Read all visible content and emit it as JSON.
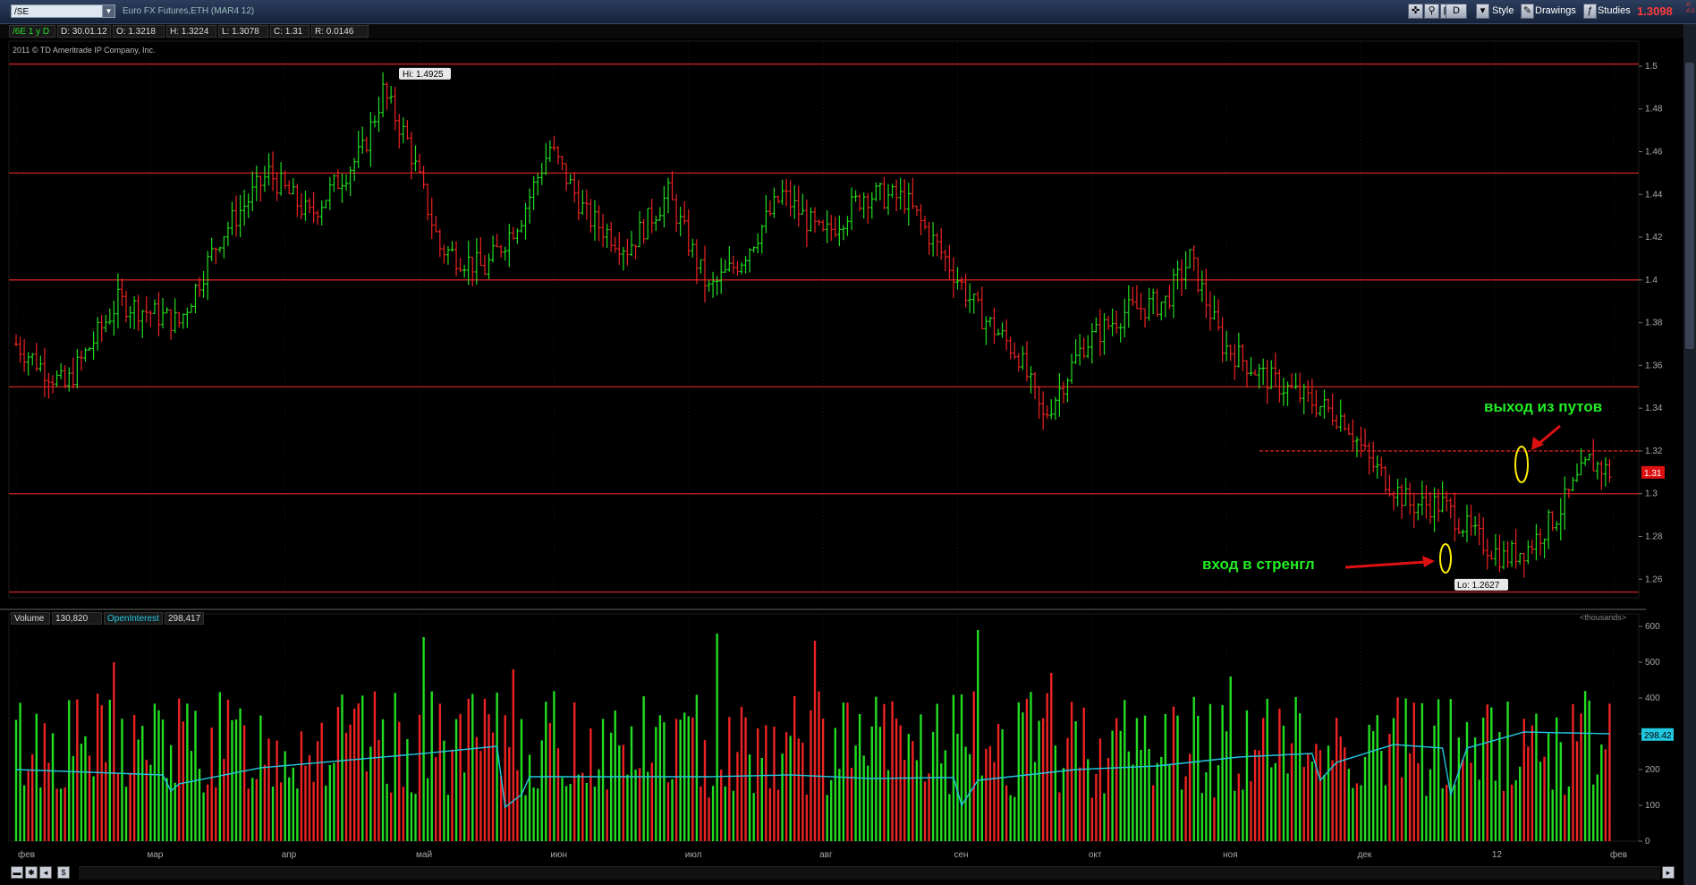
{
  "toolbar": {
    "symbol": "/SE",
    "description": "Euro FX Futures,ETH (MAR4 12)",
    "period_button": "D",
    "style_label": "Style",
    "drawings_label": "Drawings",
    "studies_label": "Studies",
    "last_price": "1.3098",
    "change_line1": "-0.",
    "change_line2": "-0.0"
  },
  "info": {
    "symbol_period": "/6E 1 y D",
    "date": "D: 30.01.12",
    "open": "O: 1.3218",
    "high": "H: 1.3224",
    "low": "L: 1.3078",
    "close": "C: 1.31",
    "range": "R: 0.0146",
    "copyright": "2011 © TD Ameritrade IP Company, Inc."
  },
  "volume_bar": {
    "volume_label": "Volume",
    "volume_value": "130,820",
    "oi_label": "OpenInterest",
    "oi_value": "298,417",
    "units": "<thousands>"
  },
  "annotations": {
    "exit_text": "выход из путов",
    "entry_text": "вход в стренгл"
  },
  "colors": {
    "up": "#22dd22",
    "down": "#ee2222",
    "line": "#cc2222",
    "oi": "#22c8e0",
    "bg": "#000000"
  },
  "chart_data": {
    "type": "bar",
    "price_axis": {
      "ticks": [
        "1.5",
        "1.48",
        "1.46",
        "1.44",
        "1.42",
        "1.4",
        "1.38",
        "1.36",
        "1.34",
        "1.32",
        "1.3",
        "1.28",
        "1.26"
      ],
      "range": [
        1.253,
        1.505
      ]
    },
    "volume_axis": {
      "ticks": [
        "600",
        "500",
        "400",
        "300",
        "200",
        "100",
        "0"
      ],
      "range": [
        0,
        600
      ]
    },
    "x_labels": [
      "фев",
      "мар",
      "апр",
      "май",
      "июн",
      "июл",
      "авг",
      "сен",
      "окт",
      "ноя",
      "дек",
      "12",
      "фев"
    ],
    "price_high_label": "Hi: 1.4925",
    "price_low_label": "Lo: 1.2627",
    "current_price_label": "1.31",
    "current_oi_label": "298.42",
    "levels": [
      1.501,
      1.45,
      1.4,
      1.35,
      1.3,
      1.254
    ],
    "dotted_level": 1.32,
    "anchors": [
      [
        0,
        1.37
      ],
      [
        12,
        1.35
      ],
      [
        25,
        1.39
      ],
      [
        40,
        1.38
      ],
      [
        50,
        1.42
      ],
      [
        62,
        1.45
      ],
      [
        72,
        1.43
      ],
      [
        85,
        1.46
      ],
      [
        90,
        1.488
      ],
      [
        96,
        1.465
      ],
      [
        104,
        1.415
      ],
      [
        115,
        1.405
      ],
      [
        124,
        1.43
      ],
      [
        131,
        1.462
      ],
      [
        140,
        1.43
      ],
      [
        150,
        1.415
      ],
      [
        160,
        1.44
      ],
      [
        170,
        1.395
      ],
      [
        178,
        1.41
      ],
      [
        188,
        1.44
      ],
      [
        198,
        1.42
      ],
      [
        208,
        1.44
      ],
      [
        218,
        1.438
      ],
      [
        228,
        1.41
      ],
      [
        236,
        1.385
      ],
      [
        246,
        1.365
      ],
      [
        252,
        1.335
      ],
      [
        262,
        1.37
      ],
      [
        272,
        1.385
      ],
      [
        282,
        1.39
      ],
      [
        288,
        1.41
      ],
      [
        296,
        1.37
      ],
      [
        306,
        1.355
      ],
      [
        316,
        1.345
      ],
      [
        326,
        1.335
      ],
      [
        332,
        1.315
      ],
      [
        342,
        1.295
      ],
      [
        350,
        1.295
      ],
      [
        358,
        1.28
      ],
      [
        365,
        1.27
      ],
      [
        371,
        1.275
      ],
      [
        378,
        1.29
      ],
      [
        386,
        1.315
      ],
      [
        391,
        1.31
      ]
    ],
    "oi_points": [
      [
        0,
        200
      ],
      [
        24,
        190
      ],
      [
        36,
        185
      ],
      [
        38,
        140
      ],
      [
        40,
        160
      ],
      [
        60,
        205
      ],
      [
        80,
        225
      ],
      [
        100,
        245
      ],
      [
        118,
        265
      ],
      [
        120,
        95
      ],
      [
        124,
        130
      ],
      [
        126,
        180
      ],
      [
        144,
        180
      ],
      [
        170,
        180
      ],
      [
        190,
        185
      ],
      [
        210,
        175
      ],
      [
        230,
        178
      ],
      [
        232,
        100
      ],
      [
        236,
        170
      ],
      [
        260,
        200
      ],
      [
        280,
        210
      ],
      [
        300,
        235
      ],
      [
        318,
        245
      ],
      [
        320,
        170
      ],
      [
        324,
        220
      ],
      [
        338,
        270
      ],
      [
        350,
        260
      ],
      [
        352,
        130
      ],
      [
        356,
        260
      ],
      [
        370,
        305
      ],
      [
        391,
        300
      ]
    ],
    "volume_highlights": [
      [
        24,
        500
      ],
      [
        100,
        570
      ],
      [
        122,
        480
      ],
      [
        172,
        580
      ],
      [
        196,
        560
      ],
      [
        236,
        590
      ],
      [
        254,
        470
      ],
      [
        298,
        460
      ]
    ]
  }
}
